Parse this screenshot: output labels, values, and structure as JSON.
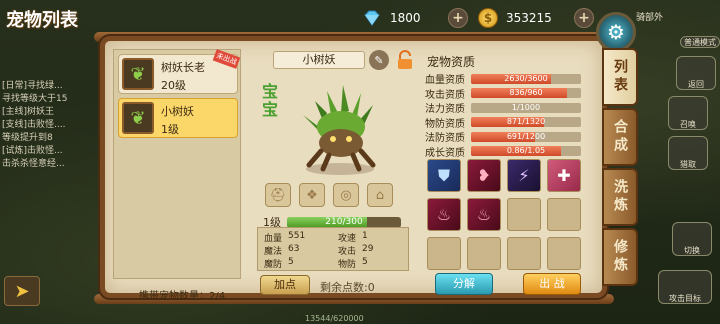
{
  "topbar": {
    "title": "宠物列表",
    "diamond": {
      "icon": "diamond-icon",
      "value": "1800"
    },
    "gold": {
      "icon": "gold-coin-icon",
      "value": "353215"
    }
  },
  "side_quests": [
    "[日常]寻找绿...",
    "寻找等级大于15",
    "[主线]树妖王",
    "[支线]击败怪....",
    "等级提升到8",
    "[试炼]击败怪...",
    "击杀杀怪意经..."
  ],
  "pet_list": [
    {
      "name": "树妖长老",
      "level": "20级",
      "tag": "未出战",
      "selected": false
    },
    {
      "name": "小树妖",
      "level": "1级",
      "selected": true
    }
  ],
  "carry_label": "携带宠物数量：",
  "carry_value": "2/4",
  "pet": {
    "name": "小树妖",
    "type_label": "宝宝",
    "level_label": "1级",
    "exp_text": "210/300",
    "exp_fraction": 0.7,
    "stats": [
      {
        "k": "血量",
        "v": "551",
        "k2": "攻速",
        "v2": "1"
      },
      {
        "k": "魔法",
        "v": "63",
        "k2": "攻击",
        "v2": "29"
      },
      {
        "k": "魔防",
        "v": "5",
        "k2": "物防",
        "v2": "5"
      }
    ],
    "add_point_label": "加点",
    "remaining_label": "剩余点数:0"
  },
  "aptitude": {
    "title": "宠物资质",
    "rows": [
      {
        "label": "血量资质",
        "value": "2630/3600",
        "fraction": 0.73
      },
      {
        "label": "攻击资质",
        "value": "836/960",
        "fraction": 0.87
      },
      {
        "label": "法力资质",
        "value": "1/1000",
        "fraction": 0.0
      },
      {
        "label": "物防资质",
        "value": "871/1320",
        "fraction": 0.66
      },
      {
        "label": "法防资质",
        "value": "691/1200",
        "fraction": 0.58
      },
      {
        "label": "成长资质",
        "value": "0.86/1.05",
        "fraction": 0.82
      }
    ]
  },
  "skills": [
    {
      "style": "s-blue",
      "icon": "shield-icon",
      "glyph": "⛊"
    },
    {
      "style": "s-red",
      "icon": "heart-icon",
      "glyph": "❥"
    },
    {
      "style": "s-purple",
      "icon": "lightning-icon",
      "glyph": "⚡"
    },
    {
      "style": "s-pink",
      "icon": "cross-icon",
      "glyph": "✚"
    },
    {
      "style": "s-red",
      "icon": "fire-shield-icon",
      "glyph": "♨"
    },
    {
      "style": "s-red",
      "icon": "fire-shield-icon",
      "glyph": "♨"
    },
    {
      "style": "",
      "icon": "",
      "glyph": ""
    },
    {
      "style": "",
      "icon": "",
      "glyph": ""
    },
    {
      "style": "",
      "icon": "",
      "glyph": ""
    },
    {
      "style": "",
      "icon": "",
      "glyph": ""
    },
    {
      "style": "",
      "icon": "",
      "glyph": ""
    },
    {
      "style": "",
      "icon": "",
      "glyph": ""
    }
  ],
  "buttons": {
    "decompose": "分解",
    "fight": "出 战"
  },
  "tabs": [
    {
      "label": "列表",
      "active": true
    },
    {
      "label": "合成",
      "active": false
    },
    {
      "label": "洗炼",
      "active": false
    },
    {
      "label": "修炼",
      "active": false
    }
  ],
  "hud": {
    "user": "骑部外",
    "labels": [
      "普通模式",
      "返回",
      "召唤",
      "猎取",
      "切换",
      "攻击目标"
    ]
  },
  "coords": "13544/620000"
}
